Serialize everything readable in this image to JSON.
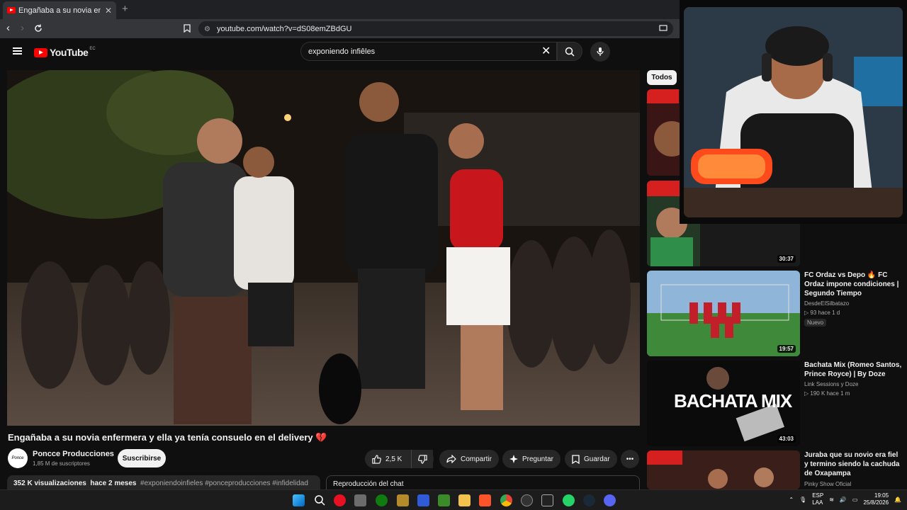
{
  "browser": {
    "tab_title": "Engañaba a su novia enfermera",
    "tab_close": "✕",
    "new_tab": "+",
    "url": "youtube.com/watch?v=dS08emZBdGU"
  },
  "youtube": {
    "logo_text": "YouTube",
    "country_code": "EC",
    "search_value": "exponiendo infiêles",
    "search_clear": "✕"
  },
  "video": {
    "title": "Engañaba a su novia enfermera y ella ya tenía consuelo en el delivery 💔",
    "channel_avatar_text": "Ponce",
    "channel_name": "Poncce Producciones",
    "subscribers": "1,85 M de suscriptores",
    "subscribe_label": "Suscribirse",
    "likes": "2,5 K",
    "share_label": "Compartir",
    "ask_label": "Preguntar",
    "save_label": "Guardar",
    "views": "352 K visualizaciones",
    "age": "hace 2 meses",
    "tags": "#exponiendoinfieles #ponceproducciones #infidelidad",
    "chat_replay": "Reproducción del chat"
  },
  "sidebar": {
    "chip": "Todos",
    "items": [
      {
        "duration": "30:37"
      },
      {
        "duration": "19:57",
        "title": "FC Ordaz vs Depo 🔥 FC Ordaz impone condiciones | Segundo Tiempo",
        "channel": "DesdeElSilbatazo",
        "meta": "▷ 93  hace 1 d",
        "badge": "Nuevo"
      },
      {
        "duration": "43:03",
        "title": "Bachata Mix (Romeo Santos, Prince Royce) | By Doze",
        "channel": "Link Sessions y Doze",
        "meta": "▷ 190 K  hace 1 m",
        "thumb_text": "BACHATA MIX"
      },
      {
        "title": "Juraba que su novio era fiel y termino siendo la cachuda de Oxapampa",
        "channel": "Pinky Show Oficial"
      }
    ]
  },
  "taskbar": {
    "lang": "ESP",
    "lang2": "LAA",
    "time": "19:05",
    "date": "25/8/2026"
  },
  "colors": {
    "bg": "#0f0f0f",
    "accent": "#ff0000",
    "chip": "#f1f1f1"
  }
}
